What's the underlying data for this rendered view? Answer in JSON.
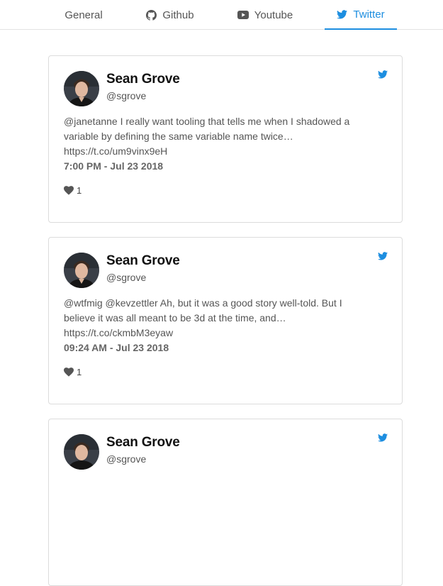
{
  "tabs": [
    {
      "label": "General",
      "icon": "none",
      "active": false
    },
    {
      "label": "Github",
      "icon": "github-icon",
      "active": false
    },
    {
      "label": "Youtube",
      "icon": "youtube-icon",
      "active": false
    },
    {
      "label": "Twitter",
      "icon": "twitter-icon",
      "active": true
    }
  ],
  "colors": {
    "accent": "#1d8ee0"
  },
  "tweets": [
    {
      "name": "Sean Grove",
      "handle": "@sgrove",
      "text": "@janetanne I really want tooling that tells me when I shadowed a variable by defining the same variable name twice… https://t.co/um9vinx9eH",
      "time": "7:00 PM - Jul 23 2018",
      "likes": "1"
    },
    {
      "name": "Sean Grove",
      "handle": "@sgrove",
      "text": "@wtfmig @kevzettler Ah, but it was a good story well-told. But I believe it was all meant to be 3d at the time, and… https://t.co/ckmbM3eyaw",
      "time": "09:24 AM - Jul 23 2018",
      "likes": "1"
    },
    {
      "name": "Sean Grove",
      "handle": "@sgrove"
    }
  ]
}
